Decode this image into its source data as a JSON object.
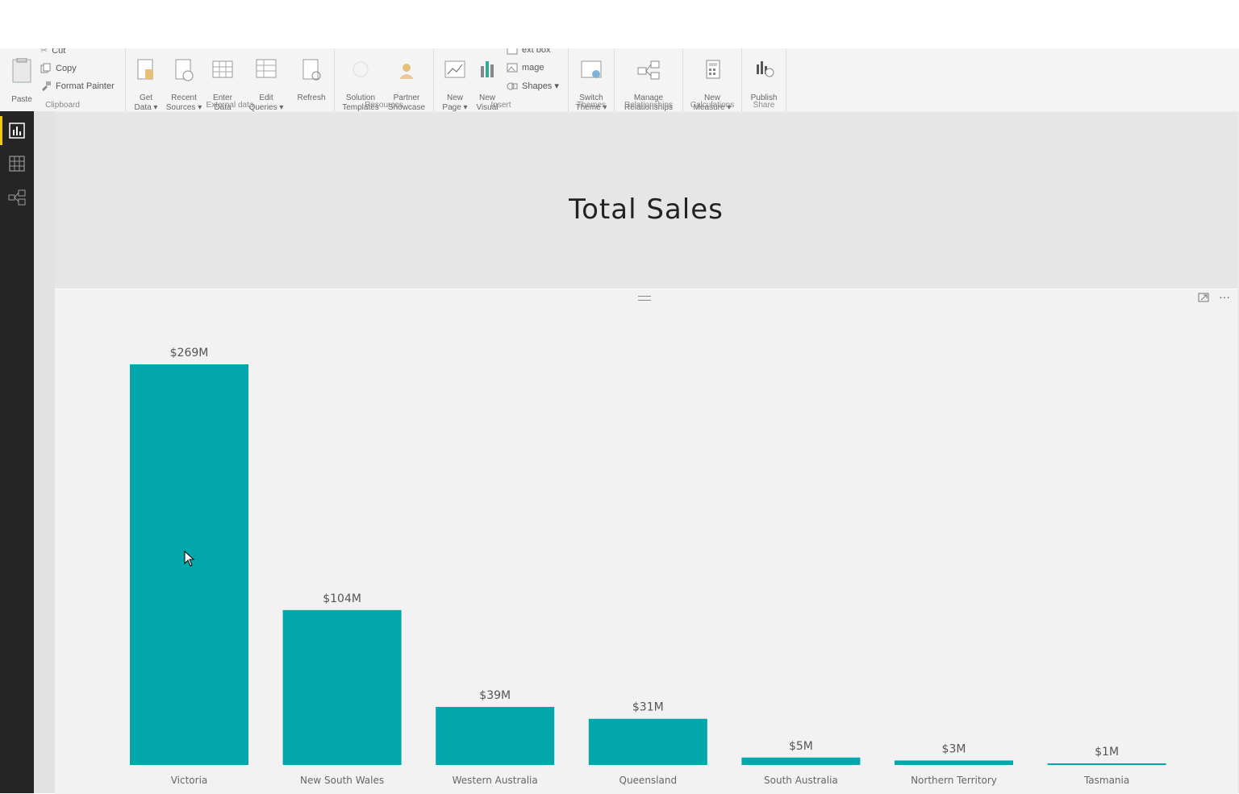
{
  "ribbon": {
    "clipboard": {
      "paste": "Paste",
      "cut": "Cut",
      "copy": "Copy",
      "format_painter": "Format Painter",
      "group_label": "Clipboard"
    },
    "external_data": {
      "get_data": "Get\nData ▾",
      "recent_sources": "Recent\nSources ▾",
      "enter_data": "Enter\nData",
      "edit_queries": "Edit\nQueries ▾",
      "refresh": "Refresh",
      "group_label": "External data"
    },
    "resources": {
      "solution_templates": "Solution\nTemplates",
      "partner_showcase": "Partner\nShowcase",
      "group_label": "Resources"
    },
    "insert": {
      "new_page": "New\nPage ▾",
      "new_visual": "New\nVisual",
      "text_box": "ext box",
      "image": "mage",
      "shapes": "Shapes ▾",
      "group_label": "Insert"
    },
    "themes": {
      "switch_theme": "Switch\nTheme ▾",
      "group_label": "Themes"
    },
    "relationships": {
      "manage_relationships": "Manage\nRelationships",
      "group_label": "Relationships"
    },
    "calculations": {
      "new_measure": "New\nMeasure ▾",
      "group_label": "Calculations"
    },
    "share": {
      "publish": "Publish",
      "group_label": "Share"
    }
  },
  "left_nav": {
    "items": [
      "report-view",
      "data-view",
      "relationships-view"
    ],
    "active": "report-view"
  },
  "report": {
    "title": "Total Sales"
  },
  "colors": {
    "bar": "#03a6ab",
    "nav_bg": "#252525",
    "accent": "#f2c811"
  },
  "visual_header": {
    "more": "···"
  },
  "chart_data": {
    "type": "bar",
    "categories": [
      "Victoria",
      "New South Wales",
      "Western Australia",
      "Queensland",
      "South Australia",
      "Northern Territory",
      "Tasmania"
    ],
    "values": [
      269,
      104,
      39,
      31,
      5,
      3,
      1
    ],
    "data_labels": [
      "$269M",
      "$104M",
      "$39M",
      "$31M",
      "$5M",
      "$3M",
      "$1M"
    ],
    "title": "",
    "xlabel": "",
    "ylabel": "",
    "ylim": [
      0,
      269
    ],
    "grid": false,
    "legend": "none"
  }
}
